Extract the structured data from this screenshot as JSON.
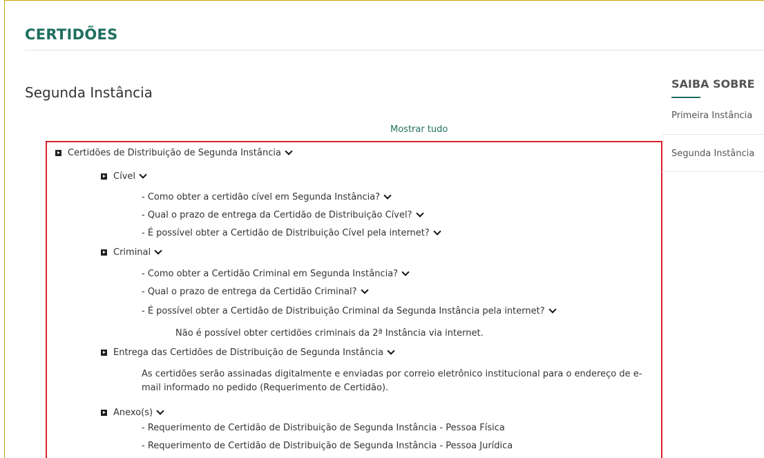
{
  "page": {
    "title": "CERTIDÕES",
    "section_title": "Segunda Instância",
    "show_all": "Mostrar tudo"
  },
  "tree": {
    "root": "Certidões de Distribuição de Segunda Instância",
    "civel": {
      "label": "Cível",
      "items": [
        "- Como obter a certidão cível em Segunda Instância?",
        "- Qual o prazo de entrega da Certidão de Distribuição Cível?",
        "- É possível obter a Certidão de Distribuição Cível pela internet?"
      ]
    },
    "criminal": {
      "label": "Criminal",
      "items": [
        "- Como obter a Certidão Criminal em Segunda Instância?",
        "- Qual o prazo de entrega da Certidão Criminal?",
        "- É possível obter a Certidão de Distribuição Criminal da Segunda Instância pela internet?"
      ],
      "answer": "Não é possível obter certidões criminais da 2ª Instância via internet."
    },
    "entrega": {
      "label": "Entrega das Certidões de Distribuição de Segunda Instância",
      "text": "As certidões serão assinadas digitalmente e enviadas por correio eletrônico institucional para o endereço de e-mail informado no pedido (Requerimento de Certidão)."
    },
    "anexos": {
      "label": "Anexo(s)",
      "items": [
        "- Requerimento de Certidão de Distribuição de Segunda Instância - Pessoa Física",
        "- Requerimento de Certidão de Distribuição de Segunda Instância - Pessoa Jurídica"
      ]
    }
  },
  "sidebar": {
    "title": "SAIBA SOBRE",
    "links": [
      "Primeira Instância",
      "Segunda Instância"
    ]
  },
  "colors": {
    "accent": "#1f6f5e",
    "highlight_border": "#d8202b",
    "frame": "#c8a400"
  },
  "icons": {
    "expand": "square-arrow-icon",
    "toggle": "chevron-down-icon"
  }
}
